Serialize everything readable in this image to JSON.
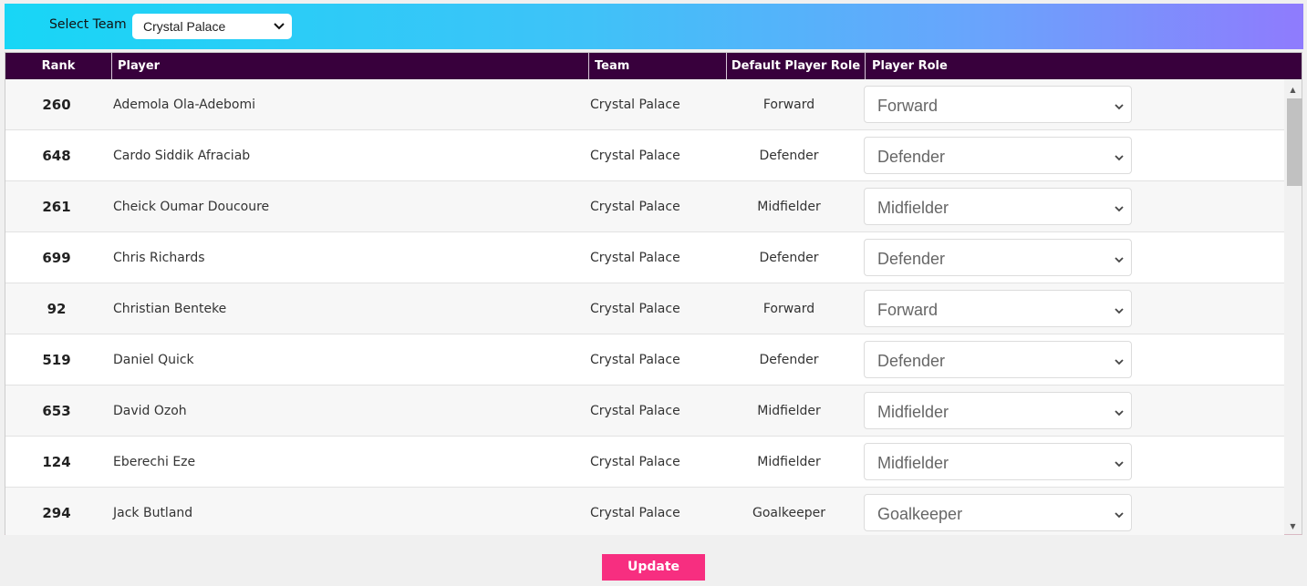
{
  "header": {
    "select_team_label": "Select Team",
    "selected_team": "Crystal Palace"
  },
  "table": {
    "columns": [
      "Rank",
      "Player",
      "Team",
      "Default Player Role",
      "Player Role"
    ],
    "rows": [
      {
        "rank": "260",
        "player": "Ademola Ola-Adebomi",
        "team": "Crystal Palace",
        "default_role": "Forward",
        "role": "Forward"
      },
      {
        "rank": "648",
        "player": "Cardo Siddik Afraciab",
        "team": "Crystal Palace",
        "default_role": "Defender",
        "role": "Defender"
      },
      {
        "rank": "261",
        "player": "Cheick Oumar Doucoure",
        "team": "Crystal Palace",
        "default_role": "Midfielder",
        "role": "Midfielder"
      },
      {
        "rank": "699",
        "player": "Chris Richards",
        "team": "Crystal Palace",
        "default_role": "Defender",
        "role": "Defender"
      },
      {
        "rank": "92",
        "player": "Christian Benteke",
        "team": "Crystal Palace",
        "default_role": "Forward",
        "role": "Forward"
      },
      {
        "rank": "519",
        "player": "Daniel Quick",
        "team": "Crystal Palace",
        "default_role": "Defender",
        "role": "Defender"
      },
      {
        "rank": "653",
        "player": "David Ozoh",
        "team": "Crystal Palace",
        "default_role": "Midfielder",
        "role": "Midfielder"
      },
      {
        "rank": "124",
        "player": "Eberechi Eze",
        "team": "Crystal Palace",
        "default_role": "Midfielder",
        "role": "Midfielder"
      },
      {
        "rank": "294",
        "player": "Jack Butland",
        "team": "Crystal Palace",
        "default_role": "Goalkeeper",
        "role": "Goalkeeper"
      }
    ]
  },
  "footer": {
    "update_label": "Update"
  },
  "colors": {
    "header_bg": "#38003c",
    "update_button": "#f72e80",
    "topbar_gradient_start": "#18d6f6",
    "topbar_gradient_end": "#8f7bfd"
  },
  "icons": {
    "dropdown": "chevron-down-icon",
    "scroll_up": "scroll-up-arrow-icon",
    "scroll_down": "scroll-down-arrow-icon"
  }
}
